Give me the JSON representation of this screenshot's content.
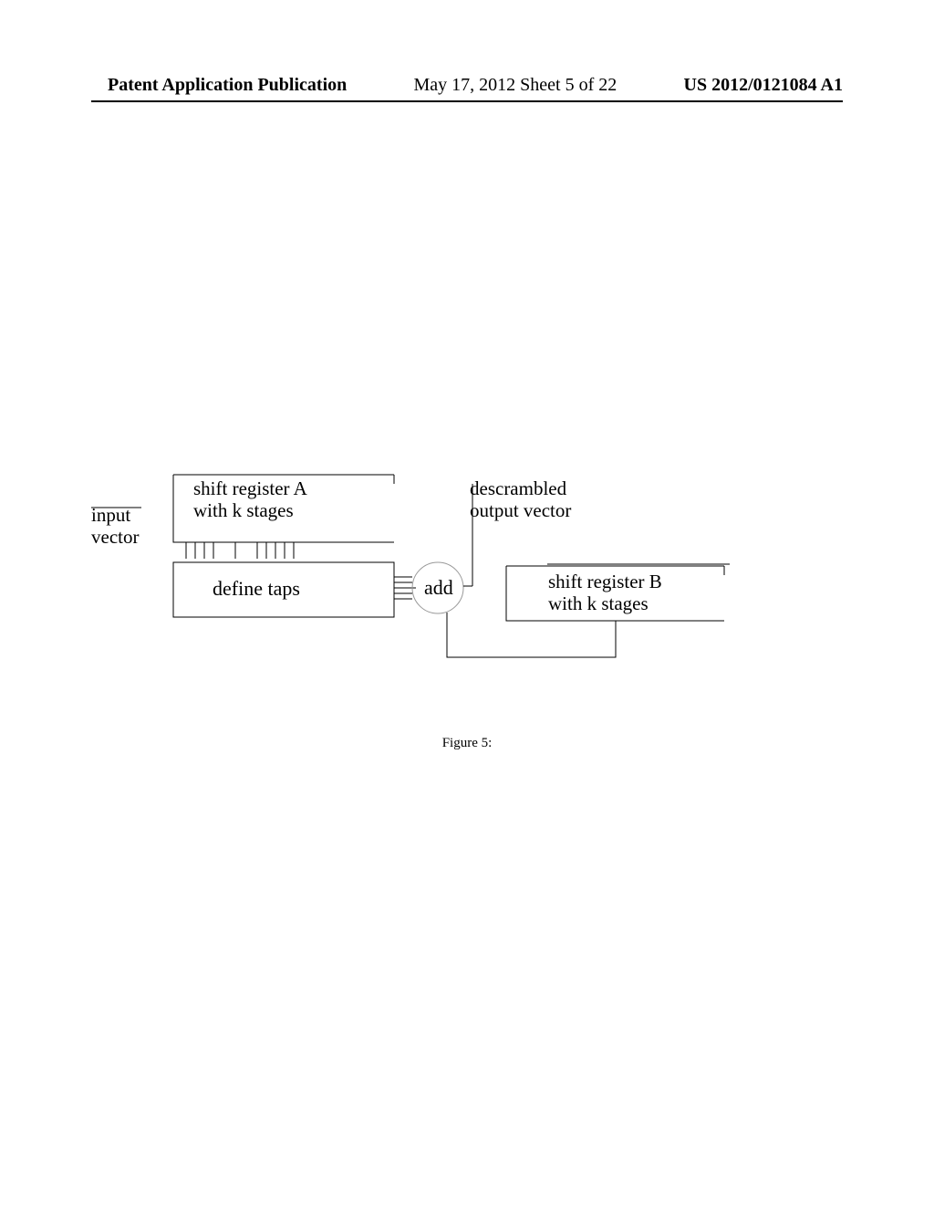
{
  "header": {
    "publication_type": "Patent Application Publication",
    "date_sheet": "May 17, 2012  Sheet 5 of 22",
    "pub_number": "US 2012/0121084 A1"
  },
  "labels": {
    "input_vector": "input\nvector",
    "shift_register_a": "shift register A\nwith k stages",
    "define_taps": "define taps",
    "add": "add",
    "descrambled_output": "descrambled\noutput vector",
    "shift_register_b": "shift register B\nwith k stages"
  },
  "caption": "Figure 5:"
}
